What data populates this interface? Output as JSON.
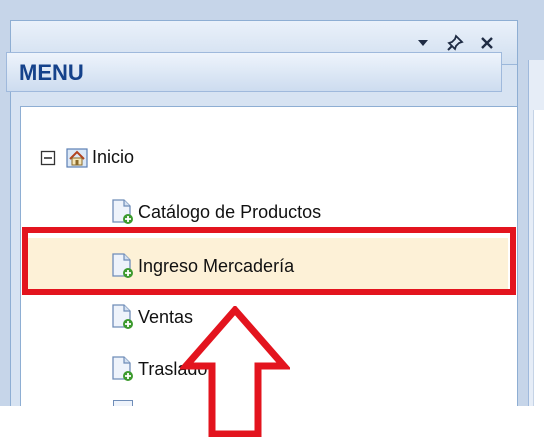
{
  "panel": {
    "header_buttons": [
      {
        "icon": "dropdown-arrow-icon"
      },
      {
        "icon": "pin-icon"
      },
      {
        "icon": "close-icon"
      }
    ]
  },
  "menu": {
    "title": "MENU"
  },
  "tree": {
    "root": {
      "label": "Inicio",
      "expander": "⊟",
      "icon": "home-icon"
    },
    "children": [
      {
        "label": "Catálogo de Productos",
        "icon": "document-add-icon"
      },
      {
        "label": "Ingreso Mercadería",
        "icon": "document-add-icon",
        "selected": true
      },
      {
        "label": "Ventas",
        "icon": "document-add-icon"
      },
      {
        "label": "Traslado",
        "icon": "document-add-icon"
      }
    ]
  },
  "annotation": {
    "box_color": "#e3141e",
    "arrow_color": "#e3141e",
    "target": "Ingreso Mercadería"
  },
  "colors": {
    "menu_title": "#15428b",
    "selection_fill": "#fdf1d7",
    "panel_bg": "#d7e3f2"
  }
}
